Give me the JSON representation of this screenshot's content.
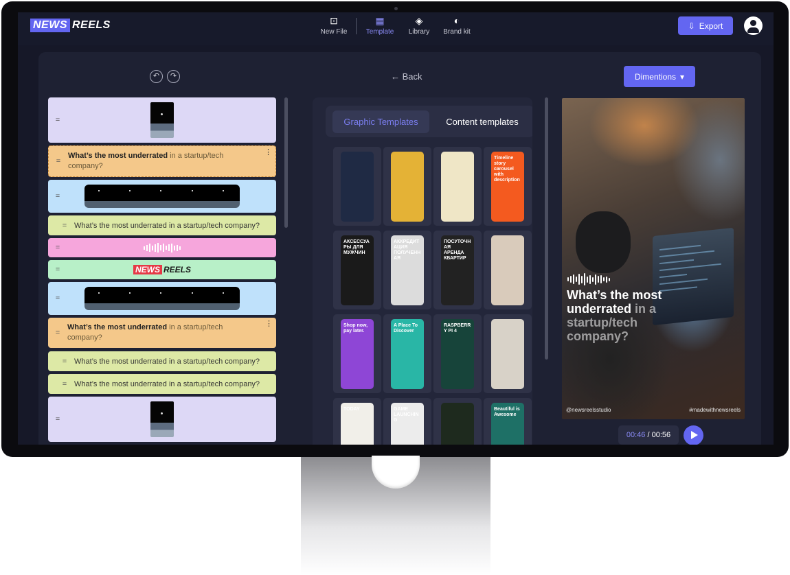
{
  "logo": {
    "news": "NEWS",
    "reels": "REELS"
  },
  "nav": [
    {
      "label": "New File",
      "icon": "new-file-icon",
      "glyph": "⊡"
    },
    {
      "label": "Template",
      "icon": "template-icon",
      "glyph": "▦"
    },
    {
      "label": "Library",
      "icon": "library-icon",
      "glyph": "◈"
    },
    {
      "label": "Brand kit",
      "icon": "palette-icon",
      "glyph": "◐"
    }
  ],
  "header": {
    "export_label": "Export"
  },
  "toolbar": {
    "back_label": "Back",
    "dimensions_label": "Dimentions",
    "undo_glyph": "↶",
    "redo_glyph": "↷",
    "back_glyph": "←",
    "caret_glyph": "▾"
  },
  "scenes": {
    "grip": "=",
    "kebab": "⋮",
    "question_strong": "What’s the most underrated",
    "question_soft": " in a startup/tech company?",
    "question_plain": "What’s the most underrated in a startup/tech company?",
    "logo_news": "NEWS",
    "logo_reels": "REELS",
    "colors": {
      "lavender": "#ddd8f6",
      "orange": "#f4c88a",
      "blue": "#bfe1fb",
      "olive": "#dde9a6",
      "pink": "#f6a6dc",
      "mint": "#b8f0c8"
    }
  },
  "templates": {
    "tab_graphic": "Graphic Templates",
    "tab_content": "Content templates",
    "cards": [
      {
        "text": "",
        "bg": "#1f2a44"
      },
      {
        "text": "",
        "bg": "#e4b236"
      },
      {
        "text": "",
        "bg": "#efe6c6"
      },
      {
        "text": "Timeline story carousel with description",
        "bg": "#f45a1f"
      },
      {
        "text": "АКСЕССУАРЫ ДЛЯ МУЖЧИН",
        "bg": "#1a1a1a"
      },
      {
        "text": "АККРЕДИТАЦИЯ ПОЛУЧЕННАЯ",
        "bg": "#dcdcdc"
      },
      {
        "text": "ПОСУТОЧНАЯ АРЕНДА КВАРТИР",
        "bg": "#222222"
      },
      {
        "text": "",
        "bg": "#d9cbbb"
      },
      {
        "text": "Shop now, pay later.",
        "bg": "#8e46d6"
      },
      {
        "text": "A Place To Discover",
        "bg": "#29b6a6"
      },
      {
        "text": "RASPBERRY PI 4",
        "bg": "#17443a"
      },
      {
        "text": "",
        "bg": "#d8d2c8"
      },
      {
        "text": "TODAY",
        "bg": "#f1efe9"
      },
      {
        "text": "GAME LAUNCHING",
        "bg": "#ececec"
      },
      {
        "text": "",
        "bg": "#1e2a1e"
      },
      {
        "text": "Beautiful is Awesome",
        "bg": "#1e7066"
      }
    ]
  },
  "preview": {
    "headline_strong": "What’s the most underrated",
    "headline_soft": " in a startup/tech company?",
    "handle_left": "@newsreelsstudio",
    "handle_right": "#madewithnewsreels",
    "time_current": "00:46",
    "time_sep": " / ",
    "time_total": "00:56"
  }
}
